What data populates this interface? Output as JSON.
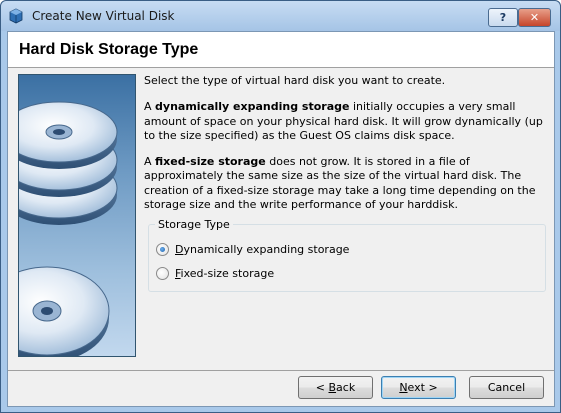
{
  "window": {
    "title": "Create New Virtual Disk",
    "help_label": "?",
    "close_label": "✕"
  },
  "page": {
    "title": "Hard Disk Storage Type",
    "intro": "Select the type of virtual hard disk you want to create.",
    "dynamic_para": {
      "prefix": "A ",
      "bold": "dynamically expanding storage",
      "rest": " initially occupies a very small amount of space on your physical hard disk. It will grow dynamically (up to the size specified) as the Guest OS claims disk space."
    },
    "fixed_para": {
      "prefix": "A ",
      "bold": "fixed-size storage",
      "rest": " does not grow. It is stored in a file of approximately the same size as the size of the virtual hard disk. The creation of a fixed-size storage may take a long time depending on the storage size and the write performance of your harddisk."
    }
  },
  "storage_type": {
    "group_label": "Storage Type",
    "options": [
      {
        "mnemonic": "D",
        "rest": "ynamically expanding storage",
        "checked": true
      },
      {
        "mnemonic": "F",
        "rest": "ixed-size storage",
        "checked": false
      }
    ]
  },
  "buttons": {
    "back": {
      "lead": "< ",
      "mnemonic": "B",
      "rest": "ack"
    },
    "next": {
      "mnemonic": "N",
      "rest": "ext >"
    },
    "cancel": "Cancel"
  },
  "icons": {
    "app": "virtualbox-icon",
    "watermark": "hard-disk-stack-illustration"
  }
}
